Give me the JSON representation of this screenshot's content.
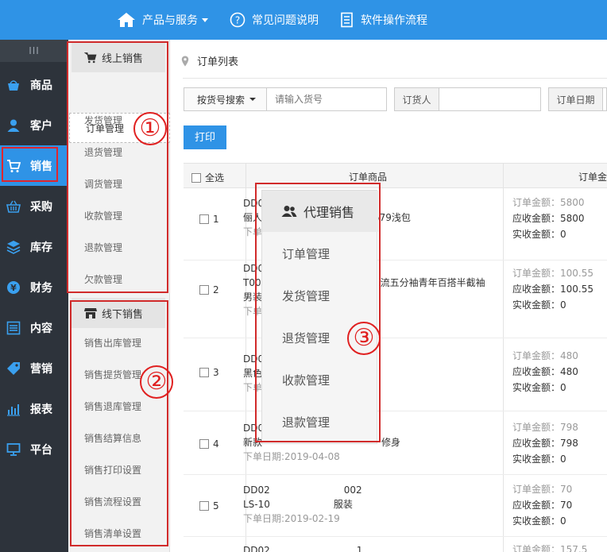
{
  "topbar": {
    "items": [
      {
        "label": "产品与服务",
        "icon": "home-icon",
        "has_caret": true
      },
      {
        "label": "常见问题说明",
        "icon": "question-circle-icon"
      },
      {
        "label": "软件操作流程",
        "icon": "document-list-icon"
      }
    ],
    "colors": {
      "primary": "#2f93e6",
      "sidebar": "#2d333b",
      "annotation": "#d12b2b"
    }
  },
  "sidebar": {
    "collapse": "III",
    "items": [
      {
        "label": "商品",
        "icon": "basket-icon"
      },
      {
        "label": "客户",
        "icon": "user-icon"
      },
      {
        "label": "销售",
        "icon": "cart-icon",
        "active": true
      },
      {
        "label": "采购",
        "icon": "shopping-basket-icon"
      },
      {
        "label": "库存",
        "icon": "layers-icon"
      },
      {
        "label": "财务",
        "icon": "yen-icon"
      },
      {
        "label": "内容",
        "icon": "list-icon"
      },
      {
        "label": "营销",
        "icon": "tag-icon"
      },
      {
        "label": "报表",
        "icon": "bar-chart-icon"
      },
      {
        "label": "平台",
        "icon": "monitor-icon"
      }
    ]
  },
  "subpanel": {
    "online": {
      "title": "线上销售",
      "items": [
        "订单管理",
        "发货管理",
        "退货管理",
        "调货管理",
        "收款管理",
        "退款管理",
        "欠款管理"
      ]
    },
    "offline": {
      "title": "线下销售",
      "items": [
        "销售出库管理",
        "销售提货管理",
        "销售退库管理",
        "销售结算信息",
        "销售打印设置",
        "销售流程设置",
        "销售清单设置"
      ]
    }
  },
  "annotations": [
    "①",
    "②",
    "③"
  ],
  "main": {
    "breadcrumb": "订单列表",
    "search": {
      "dropdown": "按货号搜索",
      "placeholder": "请输入货号",
      "orderer_label": "订货人",
      "date_label": "订单日期"
    },
    "print_button": "打印",
    "table": {
      "select_all": "全选",
      "col_product": "订单商品",
      "col_amount": "订单金",
      "rows": [
        {
          "num": "1",
          "line1": "DD0",
          "line2": "俪人",
          "line3": "579浅包",
          "date": "下单",
          "order_amount": "订单金额：5800",
          "receivable": "应收金额：5800",
          "received": "实收金额：0"
        },
        {
          "num": "2",
          "line1": "DD0",
          "line2": "T00",
          "line3": "流五分袖青年百搭半截袖",
          "line4": "男装",
          "date": "下单",
          "order_amount": "订单金额：100.55",
          "receivable": "应收金额：100.55",
          "received": "实收金额：0"
        },
        {
          "num": "3",
          "line1": "DD0",
          "line2": "黑色",
          "line3": "",
          "date": "下单",
          "order_amount": "订单金额：480",
          "receivable": "应收金额：480",
          "received": "实收金额：0"
        },
        {
          "num": "4",
          "line1": "DD0",
          "line2": "新款",
          "line3": "修身",
          "date": "下单日期:2019-04-08",
          "order_amount": "订单金额：798",
          "receivable": "应收金额：798",
          "received": "实收金额：0"
        },
        {
          "num": "5",
          "line1": "DD02",
          "line1b": "002",
          "line2": "LS-10",
          "line3": "服装",
          "date": "下单日期:2019-02-19",
          "order_amount": "订单金额：70",
          "receivable": "应收金额：70",
          "received": "实收金额：0"
        },
        {
          "num": "",
          "line1": "DD02",
          "line1b": "1",
          "order_amount": "订单金额：157.5"
        }
      ]
    }
  },
  "popup": {
    "title": "代理销售",
    "items": [
      "订单管理",
      "发货管理",
      "退货管理",
      "收款管理",
      "退款管理"
    ]
  }
}
